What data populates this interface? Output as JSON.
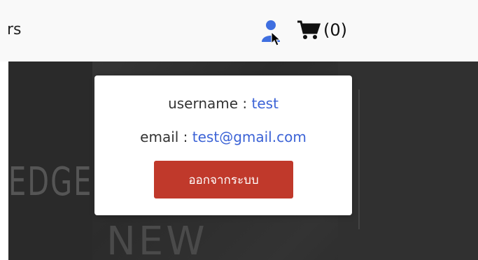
{
  "header": {
    "nav_fragment": "rs",
    "cart_count": "(0)"
  },
  "icons": {
    "user": "user-icon",
    "cart": "cart-icon"
  },
  "hero": {
    "deco_text_1": "EDGE",
    "deco_text_2": "NEW"
  },
  "popup": {
    "username_label": "username : ",
    "username_value": "test",
    "email_label": "email : ",
    "email_value": "test@gmail.com",
    "logout_label": "ออกจากระบบ"
  },
  "colors": {
    "accent_link": "#3c63d6",
    "logout_button": "#c0392b",
    "user_icon": "#3f6fe0"
  }
}
